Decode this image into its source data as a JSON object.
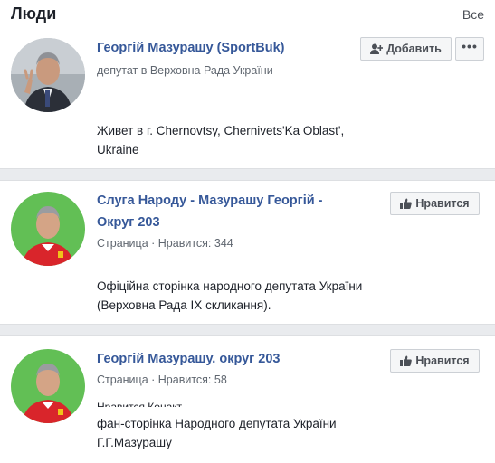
{
  "header": {
    "title": "Люди",
    "all_link": "Все"
  },
  "results": [
    {
      "name": "Георгій Мазурашу (SportBuk)",
      "subtitle": "депутат в Верховна Рада України",
      "description_lines": [
        "Живет в г. Chernovtsy, Chernivets'Ka Oblast',",
        "Ukraine"
      ],
      "primary_button": "Добавить",
      "primary_icon": "add-friend-icon",
      "more_icon": "more-icon"
    },
    {
      "name_lines": [
        "Слуга Народу - Мазурашу Георгій -",
        "Округ 203"
      ],
      "subtitle": "Страница · Нравится: 344",
      "description_lines": [
        "Офіційна сторінка народного депутата України",
        "(Верховна Рада IX скликання)."
      ],
      "primary_button": "Нравится",
      "primary_icon": "thumbs-up-icon"
    },
    {
      "name": "Георгій Мазурашу. округ 203",
      "subtitle": "Страница · Нравится: 58",
      "cropped_line": "Нравится Конакт",
      "description_lines": [
        "фан-сторінка Народного депутата України",
        "Г.Г.Мазурашу"
      ],
      "primary_button": "Нравится",
      "primary_icon": "thumbs-up-icon"
    }
  ]
}
